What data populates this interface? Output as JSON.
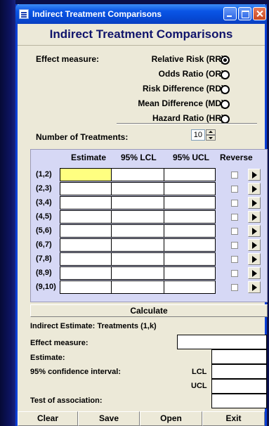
{
  "window": {
    "title": "Indirect Treatment Comparisons"
  },
  "header": {
    "title": "Indirect Treatment Comparisons"
  },
  "effect_measure": {
    "label": "Effect measure:",
    "options": [
      {
        "label": "Relative Risk (RR)",
        "selected": true
      },
      {
        "label": "Odds Ratio (OR)",
        "selected": false
      },
      {
        "label": "Risk Difference (RD)",
        "selected": false
      },
      {
        "label": "Mean Difference (MD)",
        "selected": false
      },
      {
        "label": "Hazard Ratio (HR)",
        "selected": false
      }
    ]
  },
  "treatments": {
    "label": "Number of Treatments:",
    "value": "10"
  },
  "table": {
    "columns": [
      "Estimate",
      "95% LCL",
      "95% UCL",
      "Reverse"
    ],
    "rows": [
      "(1,2)",
      "(2,3)",
      "(3,4)",
      "(4,5)",
      "(5,6)",
      "(6,7)",
      "(7,8)",
      "(8,9)",
      "(9,10)"
    ]
  },
  "calculate_label": "Calculate",
  "results": {
    "heading": "Indirect Estimate: Treatments (1,k)",
    "effect_measure": "Effect measure:",
    "estimate": "Estimate:",
    "ci": "95% confidence interval:",
    "lcl": "LCL",
    "ucl": "UCL",
    "test": "Test of association:"
  },
  "buttons": {
    "clear": "Clear",
    "save": "Save",
    "open": "Open",
    "exit": "Exit"
  },
  "colors": {
    "title_bar": "#0a55e6",
    "header_text": "#10146b",
    "table_bg": "#d6d8f5",
    "highlight_cell": "#ffff80"
  }
}
